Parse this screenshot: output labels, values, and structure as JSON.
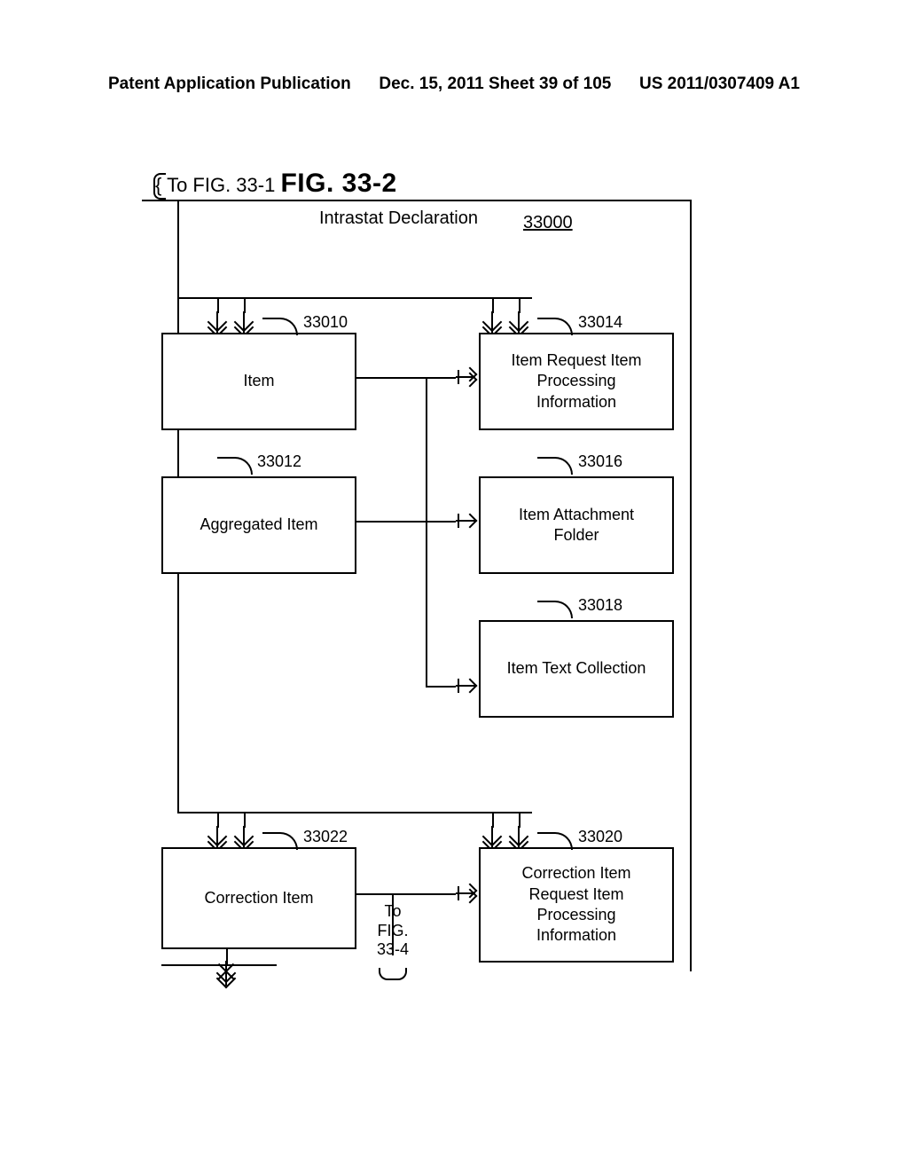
{
  "header": {
    "left": "Patent Application Publication",
    "center": "Dec. 15, 2011  Sheet 39 of 105",
    "right": "US 2011/0307409 A1"
  },
  "figure": {
    "cross_ref_prefix": "{ To FIG. 33-1",
    "title": "FIG. 33-2",
    "root_label": "Intrastat Declaration",
    "root_code": "33000",
    "continuation_label": "To\nFIG.\n33-4"
  },
  "nodes": {
    "item": {
      "label": "Item",
      "code": "33010"
    },
    "aggregated_item": {
      "label": "Aggregated Item",
      "code": "33012"
    },
    "item_req_proc": {
      "label": "Item Request Item\nProcessing\nInformation",
      "code": "33014"
    },
    "item_attach": {
      "label": "Item Attachment\nFolder",
      "code": "33016"
    },
    "item_text": {
      "label": "Item Text Collection",
      "code": "33018"
    },
    "corr_item": {
      "label": "Correction Item",
      "code": "33022"
    },
    "corr_req_proc": {
      "label": "Correction Item\nRequest Item\nProcessing\nInformation",
      "code": "33020"
    }
  }
}
